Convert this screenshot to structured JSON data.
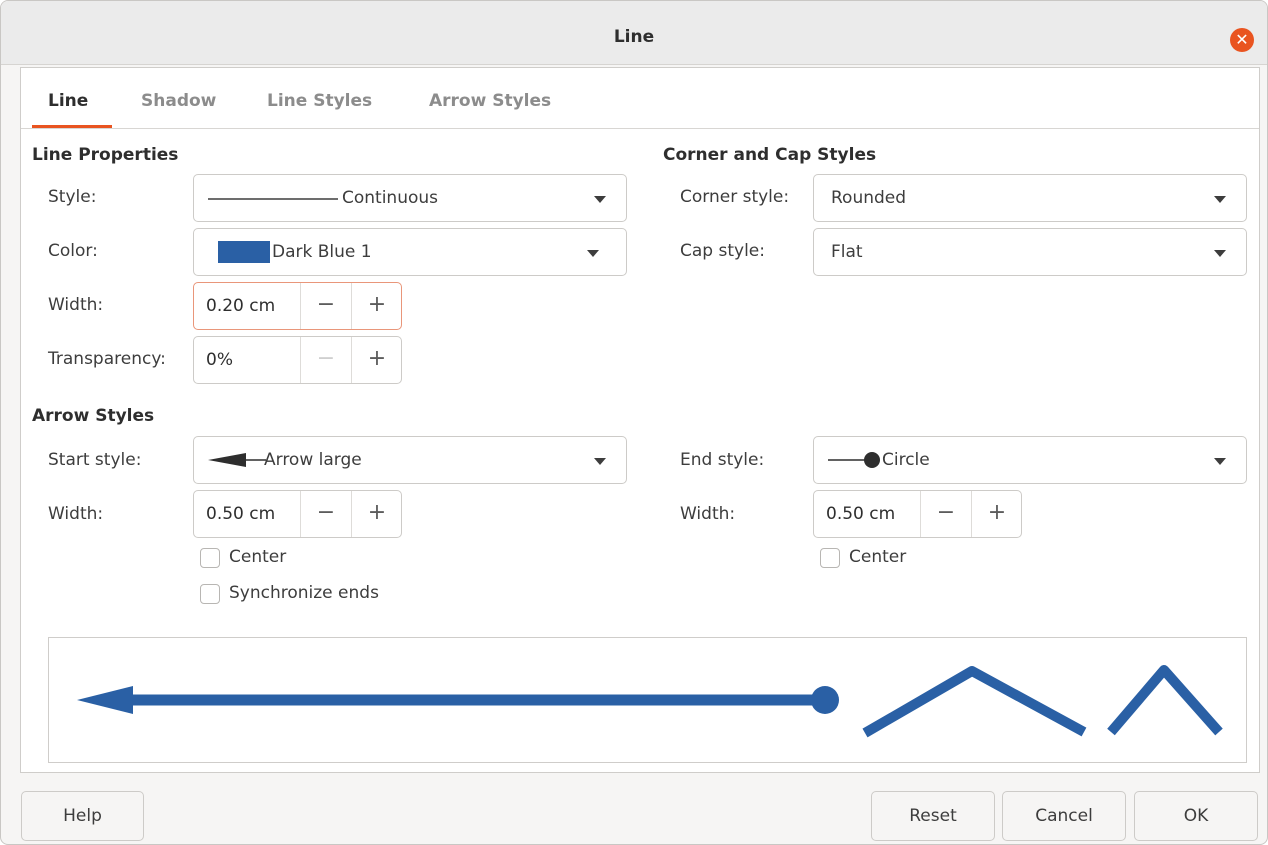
{
  "window": {
    "title": "Line"
  },
  "tabs": [
    "Line",
    "Shadow",
    "Line Styles",
    "Arrow Styles"
  ],
  "line_properties": {
    "heading": "Line Properties",
    "style_label": "Style:",
    "style_value": "Continuous",
    "color_label": "Color:",
    "color_value": "Dark Blue 1",
    "color_swatch": "#2a60a5",
    "width_label": "Width:",
    "width_value": "0.20 cm",
    "transparency_label": "Transparency:",
    "transparency_value": "0%"
  },
  "corner_cap": {
    "heading": "Corner and Cap Styles",
    "corner_label": "Corner style:",
    "corner_value": "Rounded",
    "cap_label": "Cap style:",
    "cap_value": "Flat"
  },
  "arrow_styles": {
    "heading": "Arrow Styles",
    "start_label": "Start style:",
    "start_value": "Arrow large",
    "start_width_label": "Width:",
    "start_width_value": "0.50 cm",
    "start_center_label": "Center",
    "synchronize_label": "Synchronize ends",
    "end_label": "End style:",
    "end_value": "Circle",
    "end_width_label": "Width:",
    "end_width_value": "0.50 cm",
    "end_center_label": "Center"
  },
  "spin_symbols": {
    "minus": "−",
    "plus": "+"
  },
  "buttons": {
    "help": "Help",
    "reset": "Reset",
    "cancel": "Cancel",
    "ok": "OK"
  },
  "colors": {
    "accent": "#e95420",
    "line": "#2a60a5"
  }
}
